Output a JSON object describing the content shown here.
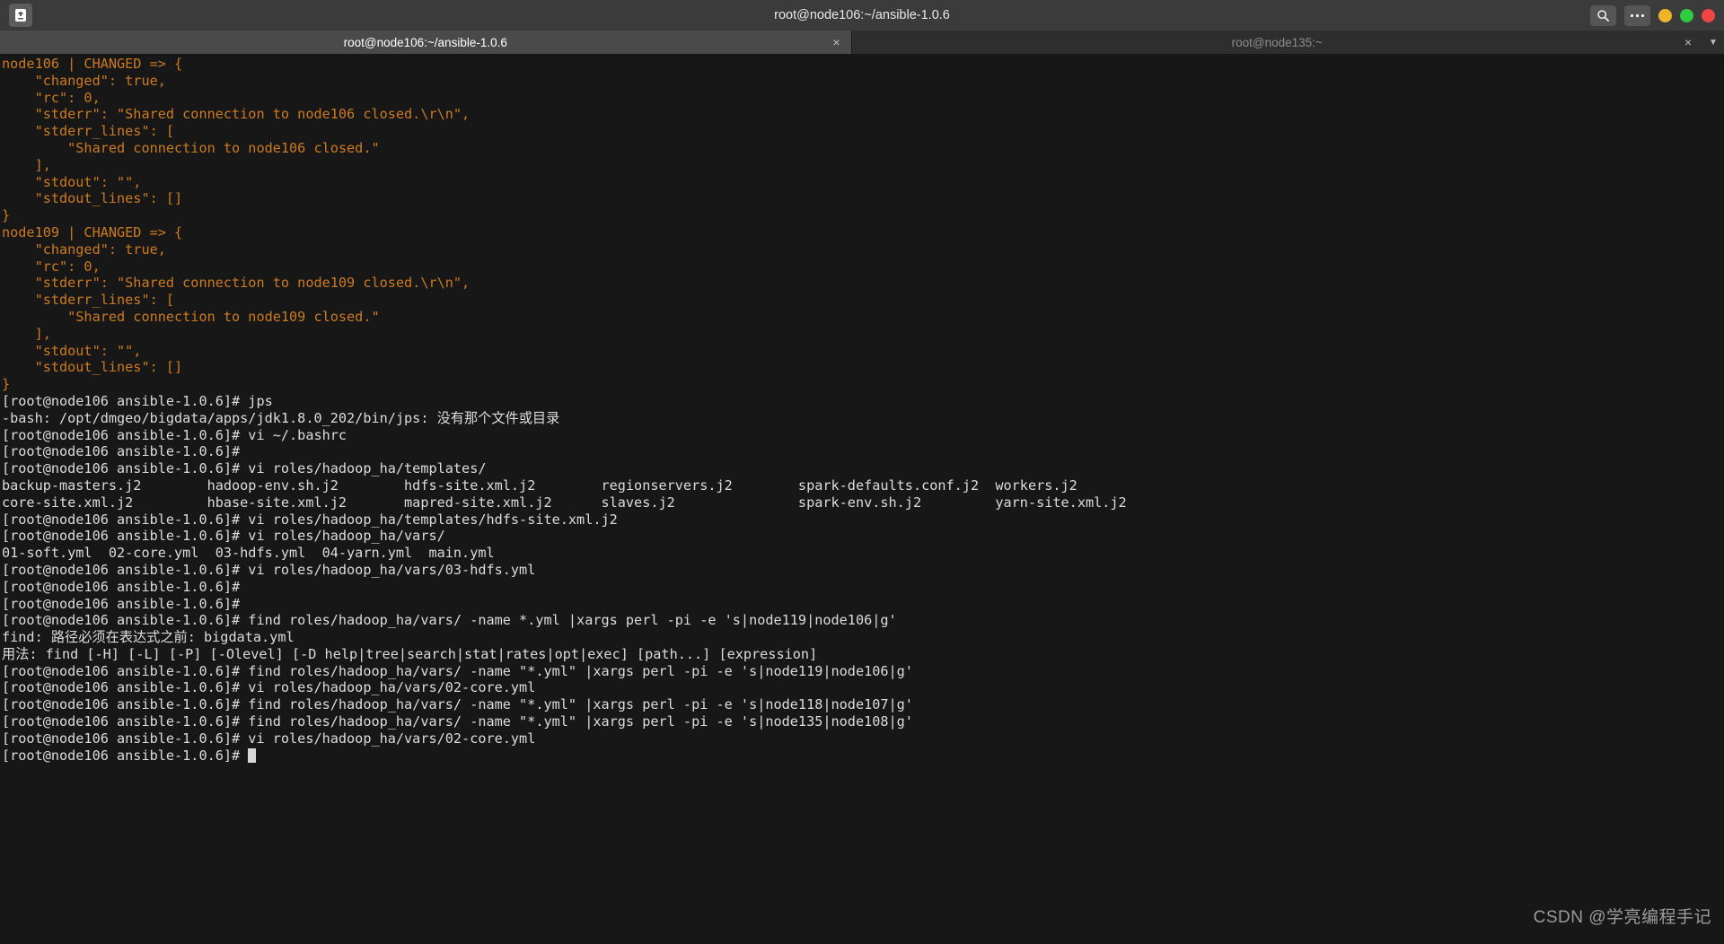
{
  "window": {
    "title": "root@node106:~/ansible-1.0.6",
    "app_icon": "terminal-icon",
    "search_icon": "search-icon",
    "menu_icon": "more-options-icon",
    "minimize_color": "#f0b429",
    "maximize_color": "#2ecc40",
    "close_color": "#ef4444"
  },
  "tabs": [
    {
      "label": "root@node106:~/ansible-1.0.6",
      "close": "×",
      "active": true
    },
    {
      "label": "root@node135:~",
      "close": "×",
      "active": false
    }
  ],
  "tabbar": {
    "menu_caret": "▼"
  },
  "terminal": {
    "background": "#171717",
    "text_color": "#d8d8d8",
    "accent_color": "#cc7a1f",
    "cursor": "block",
    "lines": [
      {
        "text": "node106 | CHANGED => {",
        "color": "amber"
      },
      {
        "text": "    \"changed\": true,",
        "color": "amber"
      },
      {
        "text": "    \"rc\": 0,",
        "color": "amber"
      },
      {
        "text": "    \"stderr\": \"Shared connection to node106 closed.\\r\\n\",",
        "color": "amber"
      },
      {
        "text": "    \"stderr_lines\": [",
        "color": "amber"
      },
      {
        "text": "        \"Shared connection to node106 closed.\"",
        "color": "amber"
      },
      {
        "text": "    ],",
        "color": "amber"
      },
      {
        "text": "    \"stdout\": \"\",",
        "color": "amber"
      },
      {
        "text": "    \"stdout_lines\": []",
        "color": "amber"
      },
      {
        "text": "}",
        "color": "amber"
      },
      {
        "text": "node109 | CHANGED => {",
        "color": "amber"
      },
      {
        "text": "    \"changed\": true,",
        "color": "amber"
      },
      {
        "text": "    \"rc\": 0,",
        "color": "amber"
      },
      {
        "text": "    \"stderr\": \"Shared connection to node109 closed.\\r\\n\",",
        "color": "amber"
      },
      {
        "text": "    \"stderr_lines\": [",
        "color": "amber"
      },
      {
        "text": "        \"Shared connection to node109 closed.\"",
        "color": "amber"
      },
      {
        "text": "    ],",
        "color": "amber"
      },
      {
        "text": "    \"stdout\": \"\",",
        "color": "amber"
      },
      {
        "text": "    \"stdout_lines\": []",
        "color": "amber"
      },
      {
        "text": "}",
        "color": "amber"
      },
      {
        "text": "[root@node106 ansible-1.0.6]# jps",
        "color": "white"
      },
      {
        "text": "-bash: /opt/dmgeo/bigdata/apps/jdk1.8.0_202/bin/jps: 没有那个文件或目录",
        "color": "white"
      },
      {
        "text": "[root@node106 ansible-1.0.6]# vi ~/.bashrc",
        "color": "white"
      },
      {
        "text": "[root@node106 ansible-1.0.6]#",
        "color": "white"
      },
      {
        "text": "[root@node106 ansible-1.0.6]# vi roles/hadoop_ha/templates/",
        "color": "white"
      },
      {
        "text": "backup-masters.j2        hadoop-env.sh.j2        hdfs-site.xml.j2        regionservers.j2        spark-defaults.conf.j2  workers.j2",
        "color": "white"
      },
      {
        "text": "core-site.xml.j2         hbase-site.xml.j2       mapred-site.xml.j2      slaves.j2               spark-env.sh.j2         yarn-site.xml.j2",
        "color": "white"
      },
      {
        "text": "[root@node106 ansible-1.0.6]# vi roles/hadoop_ha/templates/hdfs-site.xml.j2",
        "color": "white"
      },
      {
        "text": "[root@node106 ansible-1.0.6]# vi roles/hadoop_ha/vars/",
        "color": "white"
      },
      {
        "text": "01-soft.yml  02-core.yml  03-hdfs.yml  04-yarn.yml  main.yml",
        "color": "white"
      },
      {
        "text": "[root@node106 ansible-1.0.6]# vi roles/hadoop_ha/vars/03-hdfs.yml",
        "color": "white"
      },
      {
        "text": "[root@node106 ansible-1.0.6]#",
        "color": "white"
      },
      {
        "text": "[root@node106 ansible-1.0.6]#",
        "color": "white"
      },
      {
        "text": "[root@node106 ansible-1.0.6]# find roles/hadoop_ha/vars/ -name *.yml |xargs perl -pi -e 's|node119|node106|g'",
        "color": "white"
      },
      {
        "text": "find: 路径必须在表达式之前: bigdata.yml",
        "color": "white"
      },
      {
        "text": "用法: find [-H] [-L] [-P] [-Olevel] [-D help|tree|search|stat|rates|opt|exec] [path...] [expression]",
        "color": "white"
      },
      {
        "text": "[root@node106 ansible-1.0.6]# find roles/hadoop_ha/vars/ -name \"*.yml\" |xargs perl -pi -e 's|node119|node106|g'",
        "color": "white"
      },
      {
        "text": "[root@node106 ansible-1.0.6]# vi roles/hadoop_ha/vars/02-core.yml",
        "color": "white"
      },
      {
        "text": "[root@node106 ansible-1.0.6]# find roles/hadoop_ha/vars/ -name \"*.yml\" |xargs perl -pi -e 's|node118|node107|g'",
        "color": "white"
      },
      {
        "text": "[root@node106 ansible-1.0.6]# find roles/hadoop_ha/vars/ -name \"*.yml\" |xargs perl -pi -e 's|node135|node108|g'",
        "color": "white"
      },
      {
        "text": "[root@node106 ansible-1.0.6]# vi roles/hadoop_ha/vars/02-core.yml",
        "color": "white"
      }
    ],
    "prompt_last": "[root@node106 ansible-1.0.6]# "
  },
  "watermark": {
    "text": "CSDN @学亮编程手记"
  }
}
